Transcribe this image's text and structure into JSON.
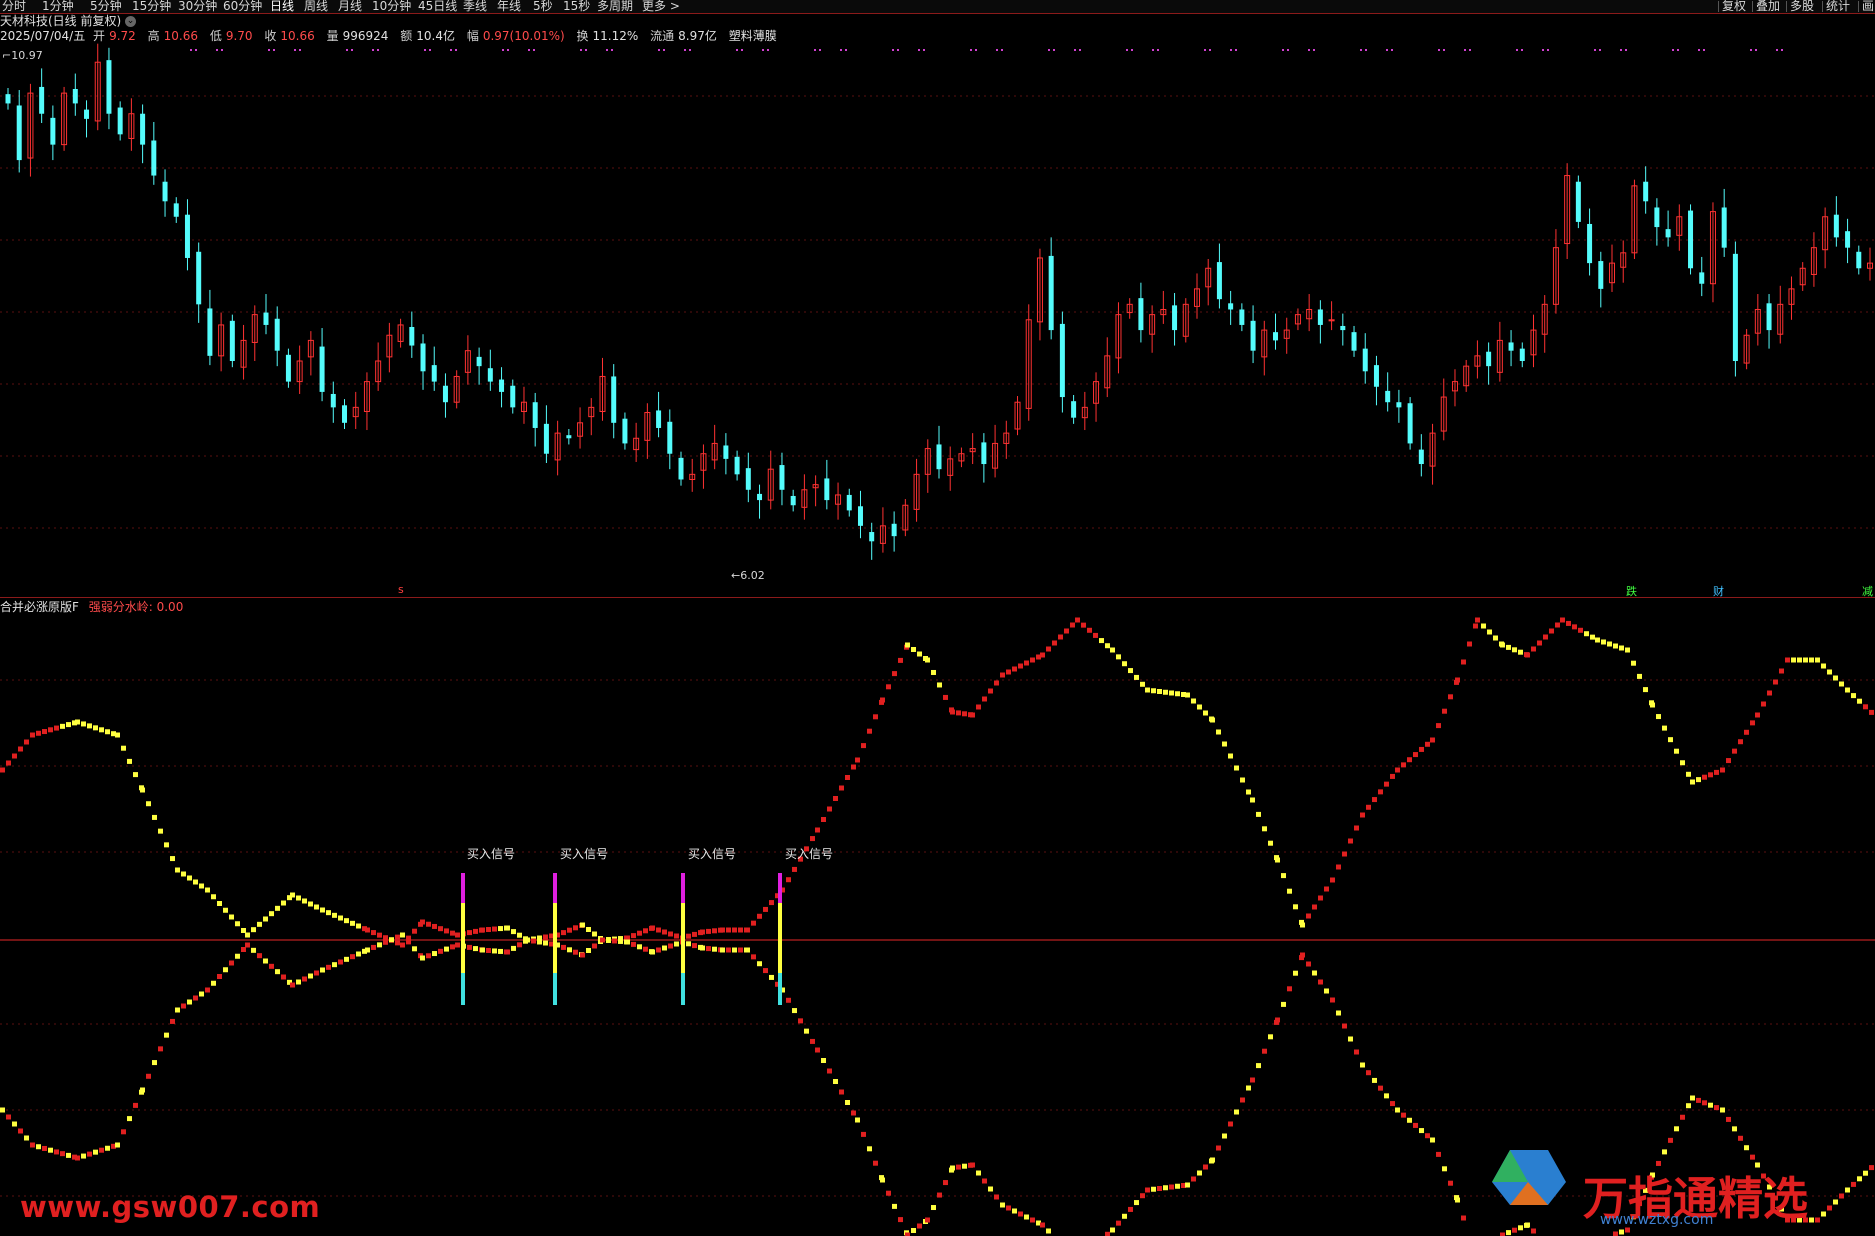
{
  "toolbar": {
    "tabs": [
      "分时",
      "1分钟",
      "5分钟",
      "15分钟",
      "30分钟",
      "60分钟",
      "日线",
      "周线",
      "月线",
      "10分钟",
      "45日线",
      "季线",
      "年线",
      "5秒",
      "15秒",
      "多周期",
      "更多 >"
    ],
    "active_tab": "日线",
    "right_buttons": [
      "复权",
      "叠加",
      "多股",
      "统计",
      "画"
    ]
  },
  "security": {
    "name": "天材科技(日线 前复权)",
    "date": "2025/07/04/五"
  },
  "quote": {
    "open_label": "开",
    "open": "9.72",
    "high_label": "高",
    "high": "10.66",
    "low_label": "低",
    "low": "9.70",
    "close_label": "收",
    "close": "10.66",
    "vol_label": "量",
    "vol": "996924",
    "amt_label": "额",
    "amt": "10.4亿",
    "chg_label": "幅",
    "chg": "0.97(10.01%)",
    "turn_label": "换",
    "turn": "11.12%",
    "float_label": "流通",
    "float": "8.97亿",
    "sector": "塑料薄膜"
  },
  "price_labels": {
    "max": "10.97",
    "min": "6.02"
  },
  "markers": {
    "s": "s",
    "events": [
      "跌",
      "财",
      "减"
    ]
  },
  "indicator": {
    "name": "合并必涨原版F",
    "param_label": "强弱分水岭:",
    "param_value": "0.00",
    "signal_text": "买入信号"
  },
  "watermarks": {
    "site": "www.gsw007.com",
    "brand": "万指通精选",
    "site2": "www.wztxg.com"
  },
  "colors": {
    "up": "#ff3232",
    "down": "#54fcfc",
    "line_red": "#e02020",
    "line_yellow": "#ffff40",
    "grid": "#5a0f0f"
  },
  "chart_data": {
    "type": "candlestick",
    "price_range": [
      6.02,
      10.97
    ],
    "closes": [
      10.5,
      9.95,
      10.6,
      10.4,
      10.1,
      10.6,
      10.5,
      10.35,
      10.9,
      10.4,
      10.2,
      10.4,
      10.1,
      9.8,
      9.55,
      9.4,
      9.0,
      8.55,
      8.05,
      8.35,
      8.0,
      8.2,
      8.45,
      8.35,
      8.1,
      7.8,
      8.0,
      8.2,
      7.7,
      7.55,
      7.4,
      7.55,
      7.8,
      8.0,
      8.25,
      8.35,
      8.15,
      7.9,
      7.8,
      7.6,
      7.85,
      8.1,
      7.95,
      7.8,
      7.7,
      7.55,
      7.6,
      7.35,
      7.1,
      7.3,
      7.25,
      7.4,
      7.55,
      7.85,
      7.4,
      7.2,
      7.25,
      7.5,
      7.35,
      7.1,
      6.85,
      6.9,
      7.1,
      7.2,
      7.05,
      6.9,
      6.75,
      6.65,
      6.95,
      6.75,
      6.6,
      6.75,
      6.8,
      6.65,
      6.7,
      6.55,
      6.4,
      6.25,
      6.4,
      6.3,
      6.6,
      6.9,
      7.15,
      6.95,
      7.05,
      7.1,
      7.15,
      7.0,
      7.2,
      7.3,
      7.6,
      8.4,
      9.0,
      8.3,
      7.65,
      7.45,
      7.55,
      7.8,
      8.05,
      8.45,
      8.55,
      8.3,
      8.45,
      8.5,
      8.3,
      8.55,
      8.7,
      8.9,
      8.6,
      8.5,
      8.35,
      8.1,
      8.3,
      8.2,
      8.3,
      8.45,
      8.5,
      8.35,
      8.4,
      8.3,
      8.1,
      7.9,
      7.75,
      7.6,
      7.55,
      7.2,
      7.0,
      7.3,
      7.65,
      7.8,
      7.95,
      8.05,
      7.95,
      8.2,
      8.1,
      8.0,
      8.3,
      8.55,
      9.1,
      9.8,
      9.35,
      8.95,
      8.7,
      8.95,
      9.05,
      9.7,
      9.55,
      9.3,
      9.2,
      9.4,
      8.9,
      8.75,
      9.45,
      9.1,
      8.0,
      8.25,
      8.5,
      8.3,
      8.55,
      8.7,
      8.9,
      9.1,
      9.4,
      9.2,
      9.1,
      8.9,
      8.95
    ],
    "indicator_series": [
      {
        "name": "red",
        "values": []
      },
      {
        "name": "yellow",
        "values": []
      }
    ],
    "buy_signal_positions": [
      463,
      555,
      683,
      780
    ]
  }
}
